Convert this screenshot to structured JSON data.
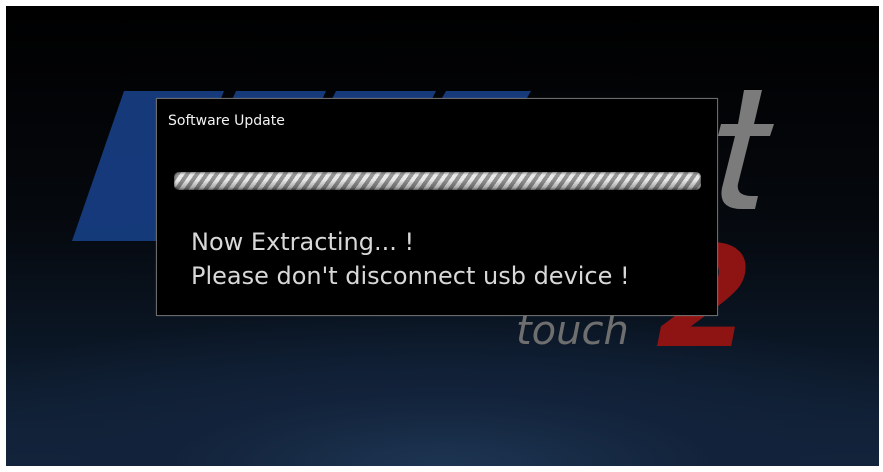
{
  "dialog": {
    "title": "Software Update",
    "progress": {
      "mode": "indeterminate",
      "style": "striped"
    },
    "message_lines": [
      "Now Extracting... !",
      "Please don't disconnect usb device !"
    ]
  },
  "background_logo": {
    "subtitle": "touch",
    "number": "2",
    "colors": {
      "primary_blue": "#173f86",
      "accent_red": "#8e1414",
      "grey": "#7b7b7b"
    }
  }
}
